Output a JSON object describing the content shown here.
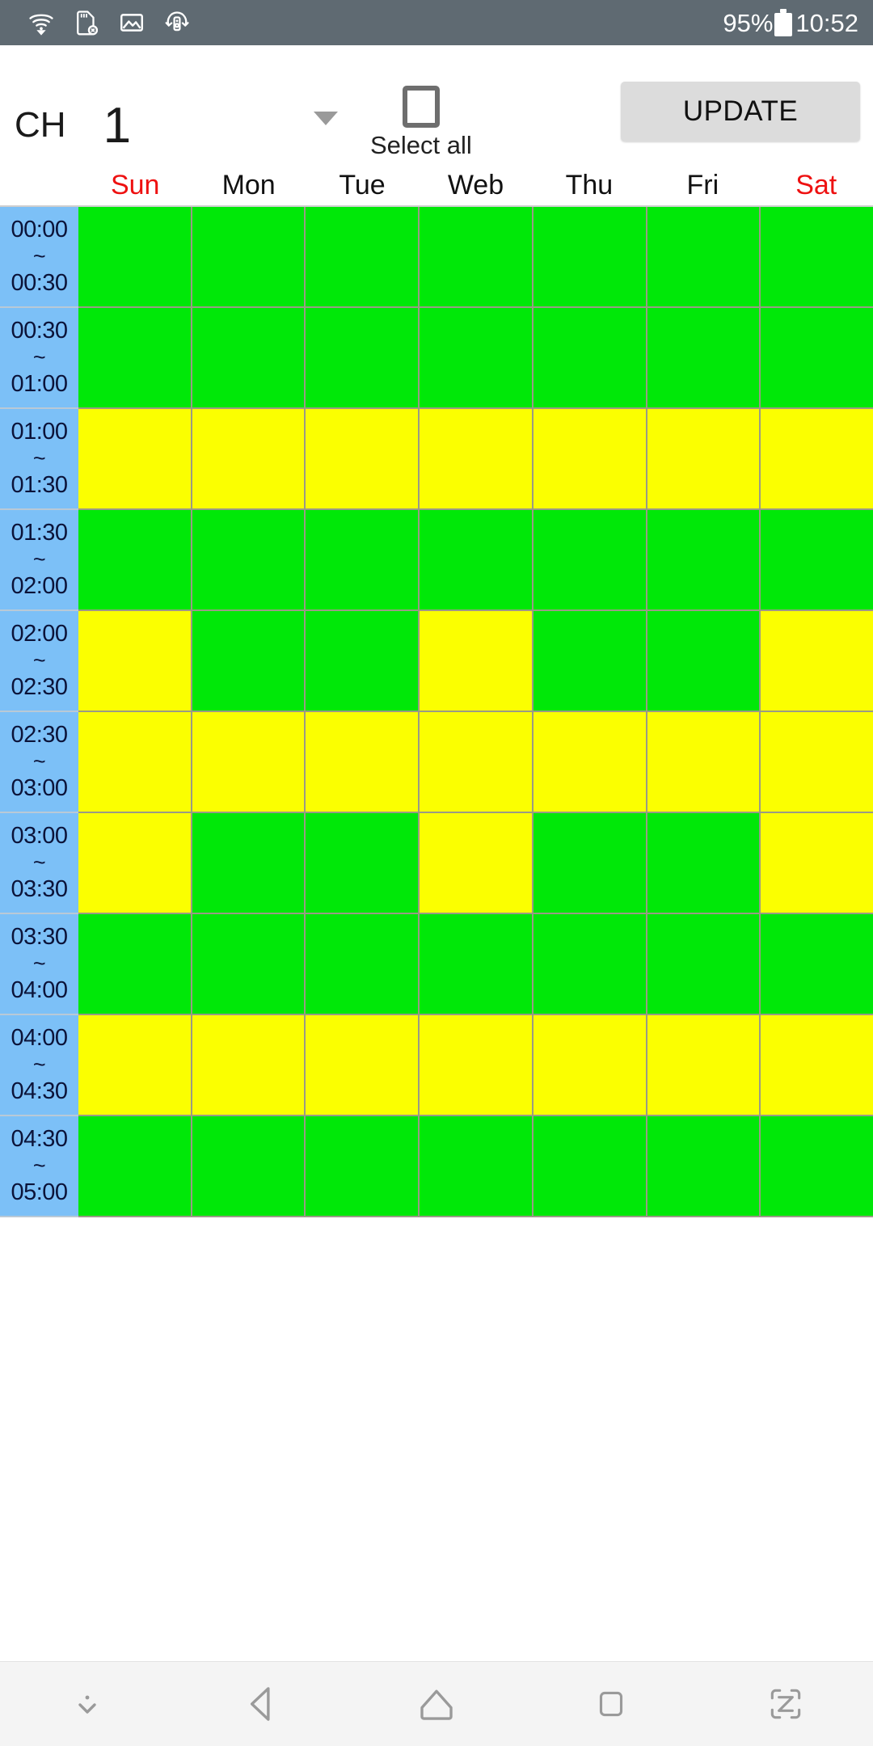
{
  "statusbar": {
    "icons": [
      "wifi-off-icon",
      "sdcard-error-icon",
      "gallery-icon",
      "sync-rotate-icon"
    ],
    "battery_percent": "95%",
    "time": "10:52",
    "bg_color": "#5f6a72"
  },
  "header": {
    "ch_label": "CH",
    "ch_value": "1",
    "dropdown_icon": "chevron-down-icon",
    "select_all_label": "Select all",
    "select_all_checked": false,
    "update_label": "UPDATE"
  },
  "days": [
    {
      "label": "Sun",
      "weekend": true
    },
    {
      "label": "Mon",
      "weekend": false
    },
    {
      "label": "Tue",
      "weekend": false
    },
    {
      "label": "Web",
      "weekend": false
    },
    {
      "label": "Thu",
      "weekend": false
    },
    {
      "label": "Fri",
      "weekend": false
    },
    {
      "label": "Sat",
      "weekend": true
    }
  ],
  "colors": {
    "green": "#00e808",
    "yellow": "#fbff00",
    "time_column": "#7cc0f7",
    "weekend_text": "#ee1111",
    "update_button": "#dcdcdc"
  },
  "schedule": {
    "separator": "~",
    "rows": [
      {
        "start": "00:00",
        "end": "00:30",
        "cells": [
          "green",
          "green",
          "green",
          "green",
          "green",
          "green",
          "green"
        ]
      },
      {
        "start": "00:30",
        "end": "01:00",
        "cells": [
          "green",
          "green",
          "green",
          "green",
          "green",
          "green",
          "green"
        ]
      },
      {
        "start": "01:00",
        "end": "01:30",
        "cells": [
          "yellow",
          "yellow",
          "yellow",
          "yellow",
          "yellow",
          "yellow",
          "yellow"
        ]
      },
      {
        "start": "01:30",
        "end": "02:00",
        "cells": [
          "green",
          "green",
          "green",
          "green",
          "green",
          "green",
          "green"
        ]
      },
      {
        "start": "02:00",
        "end": "02:30",
        "cells": [
          "yellow",
          "green",
          "green",
          "yellow",
          "green",
          "green",
          "yellow"
        ]
      },
      {
        "start": "02:30",
        "end": "03:00",
        "cells": [
          "yellow",
          "yellow",
          "yellow",
          "yellow",
          "yellow",
          "yellow",
          "yellow"
        ]
      },
      {
        "start": "03:00",
        "end": "03:30",
        "cells": [
          "yellow",
          "green",
          "green",
          "yellow",
          "green",
          "green",
          "yellow"
        ]
      },
      {
        "start": "03:30",
        "end": "04:00",
        "cells": [
          "green",
          "green",
          "green",
          "green",
          "green",
          "green",
          "green"
        ]
      },
      {
        "start": "04:00",
        "end": "04:30",
        "cells": [
          "yellow",
          "yellow",
          "yellow",
          "yellow",
          "yellow",
          "yellow",
          "yellow"
        ]
      },
      {
        "start": "04:30",
        "end": "05:00",
        "cells": [
          "green",
          "green",
          "green",
          "green",
          "green",
          "green",
          "green"
        ]
      }
    ]
  },
  "navbar": {
    "items": [
      "hide-navbar-icon",
      "back-icon",
      "home-icon",
      "recents-icon",
      "fullscreen-icon"
    ]
  }
}
